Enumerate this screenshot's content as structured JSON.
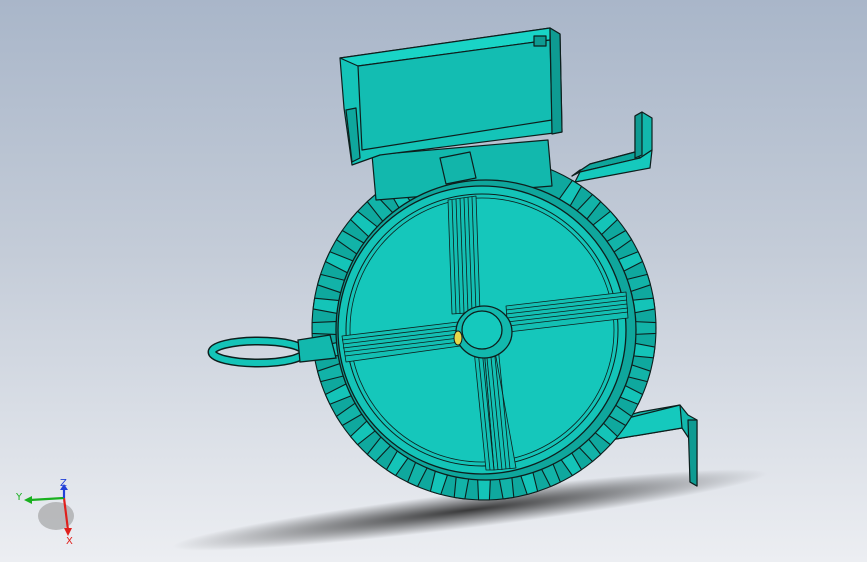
{
  "viewport": {
    "background_top": "#a9b6c9",
    "background_bottom": "#eceef2",
    "model_color": "#14c4b8",
    "model_edge_color": "#0d1f1d"
  },
  "model": {
    "icon": "electric-motor-icon"
  },
  "triad": {
    "x_label": "X",
    "y_label": "Y",
    "z_label": "Z",
    "x_color": "#e0201c",
    "y_color": "#19b01f",
    "z_color": "#2240d8"
  }
}
